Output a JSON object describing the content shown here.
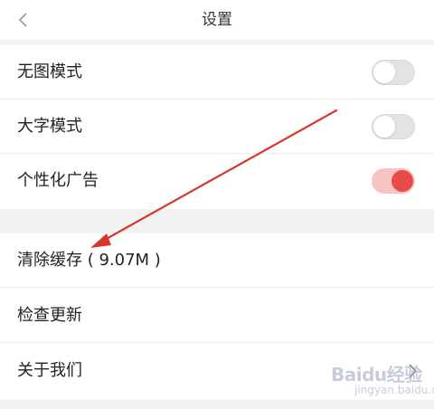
{
  "header": {
    "title": "设置",
    "back_icon": "chevron-left-icon"
  },
  "settings_group_1": [
    {
      "label": "无图模式",
      "toggle_on": false
    },
    {
      "label": "大字模式",
      "toggle_on": false
    },
    {
      "label": "个性化广告",
      "toggle_on": true
    }
  ],
  "settings_group_2": [
    {
      "label": "清除缓存 ( 9.07M )"
    },
    {
      "label": "检查更新"
    },
    {
      "label": "关于我们",
      "icon": "chevron-right-icon"
    }
  ],
  "annotation": {
    "color": "#d9362b"
  },
  "watermark": {
    "main": "Baidu经验",
    "sub": "jingyan.baidu.com"
  },
  "colors": {
    "toggle_on_knob": "#e94b4b",
    "toggle_on_track": "#f7c3c3",
    "toggle_off_track": "#e3e3e3"
  }
}
